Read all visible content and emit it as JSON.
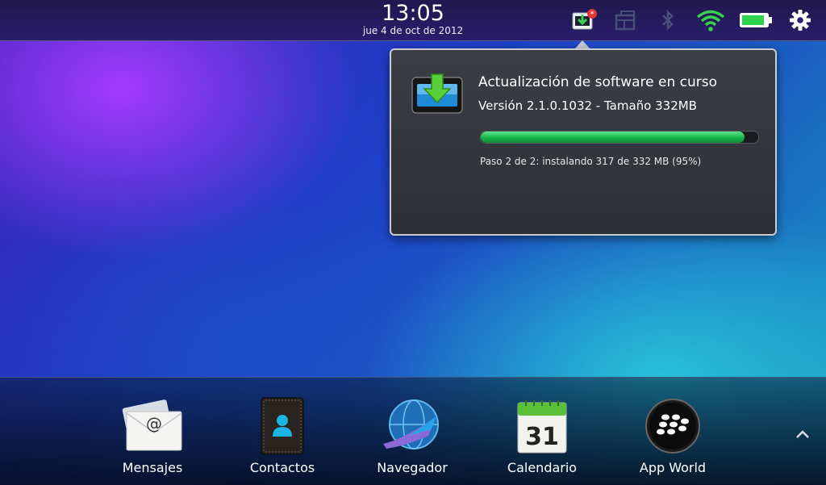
{
  "status_bar": {
    "time": "13:05",
    "date": "jue 4 de oct de 2012",
    "icons": [
      "download-notification-icon",
      "window-switch-icon",
      "bluetooth-icon",
      "wifi-icon",
      "battery-icon",
      "settings-gear-icon"
    ],
    "battery_level": 0.9,
    "accent_color": "#2bd44a"
  },
  "popup": {
    "title": "Actualización de software en curso",
    "version": "Versión 2.1.0.1032 - Tamaño 332MB",
    "progress": 0.95,
    "step_text": "Paso 2 de 2: instalando 317 de 332 MB (95%)",
    "icon": "software-update-icon"
  },
  "dock": {
    "apps": [
      {
        "label": "Mensajes",
        "icon": "mail-envelope-icon"
      },
      {
        "label": "Contactos",
        "icon": "contacts-book-icon"
      },
      {
        "label": "Navegador",
        "icon": "browser-globe-icon"
      },
      {
        "label": "Calendario",
        "icon": "calendar-icon",
        "day": "31"
      },
      {
        "label": "App World",
        "icon": "blackberry-logo-icon"
      }
    ],
    "expand_icon": "chevron-up-icon"
  }
}
